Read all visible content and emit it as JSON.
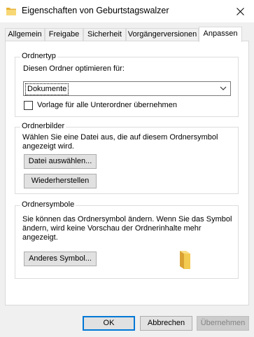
{
  "window": {
    "title": "Eigenschaften von Geburtstagswalzer"
  },
  "tabs": [
    {
      "label": "Allgemein",
      "active": false
    },
    {
      "label": "Freigabe",
      "active": false
    },
    {
      "label": "Sicherheit",
      "active": false
    },
    {
      "label": "Vorgängerversionen",
      "active": false
    },
    {
      "label": "Anpassen",
      "active": true
    }
  ],
  "ordnertyp": {
    "group_title": "Ordnertyp",
    "optimize_label": "Diesen Ordner optimieren für:",
    "optimize_value": "Dokumente",
    "template_checkbox_label": "Vorlage für alle Unterordner übernehmen",
    "template_checked": false
  },
  "ordnerbilder": {
    "group_title": "Ordnerbilder",
    "description": "Wählen Sie eine Datei aus, die auf diesem Ordnersymbol angezeigt wird.",
    "choose_file_button": "Datei auswählen...",
    "restore_button": "Wiederherstellen"
  },
  "ordnersymbole": {
    "group_title": "Ordnersymbole",
    "description": "Sie können das Ordnersymbol ändern. Wenn Sie das Symbol ändern, wird keine Vorschau der Ordnerinhalte mehr angezeigt.",
    "other_icon_button": "Anderes Symbol..."
  },
  "footer": {
    "ok_button": "OK",
    "cancel_button": "Abbrechen",
    "apply_button": "Übernehmen"
  },
  "colors": {
    "folder": "#f3c74a",
    "accent": "#0078d7"
  }
}
